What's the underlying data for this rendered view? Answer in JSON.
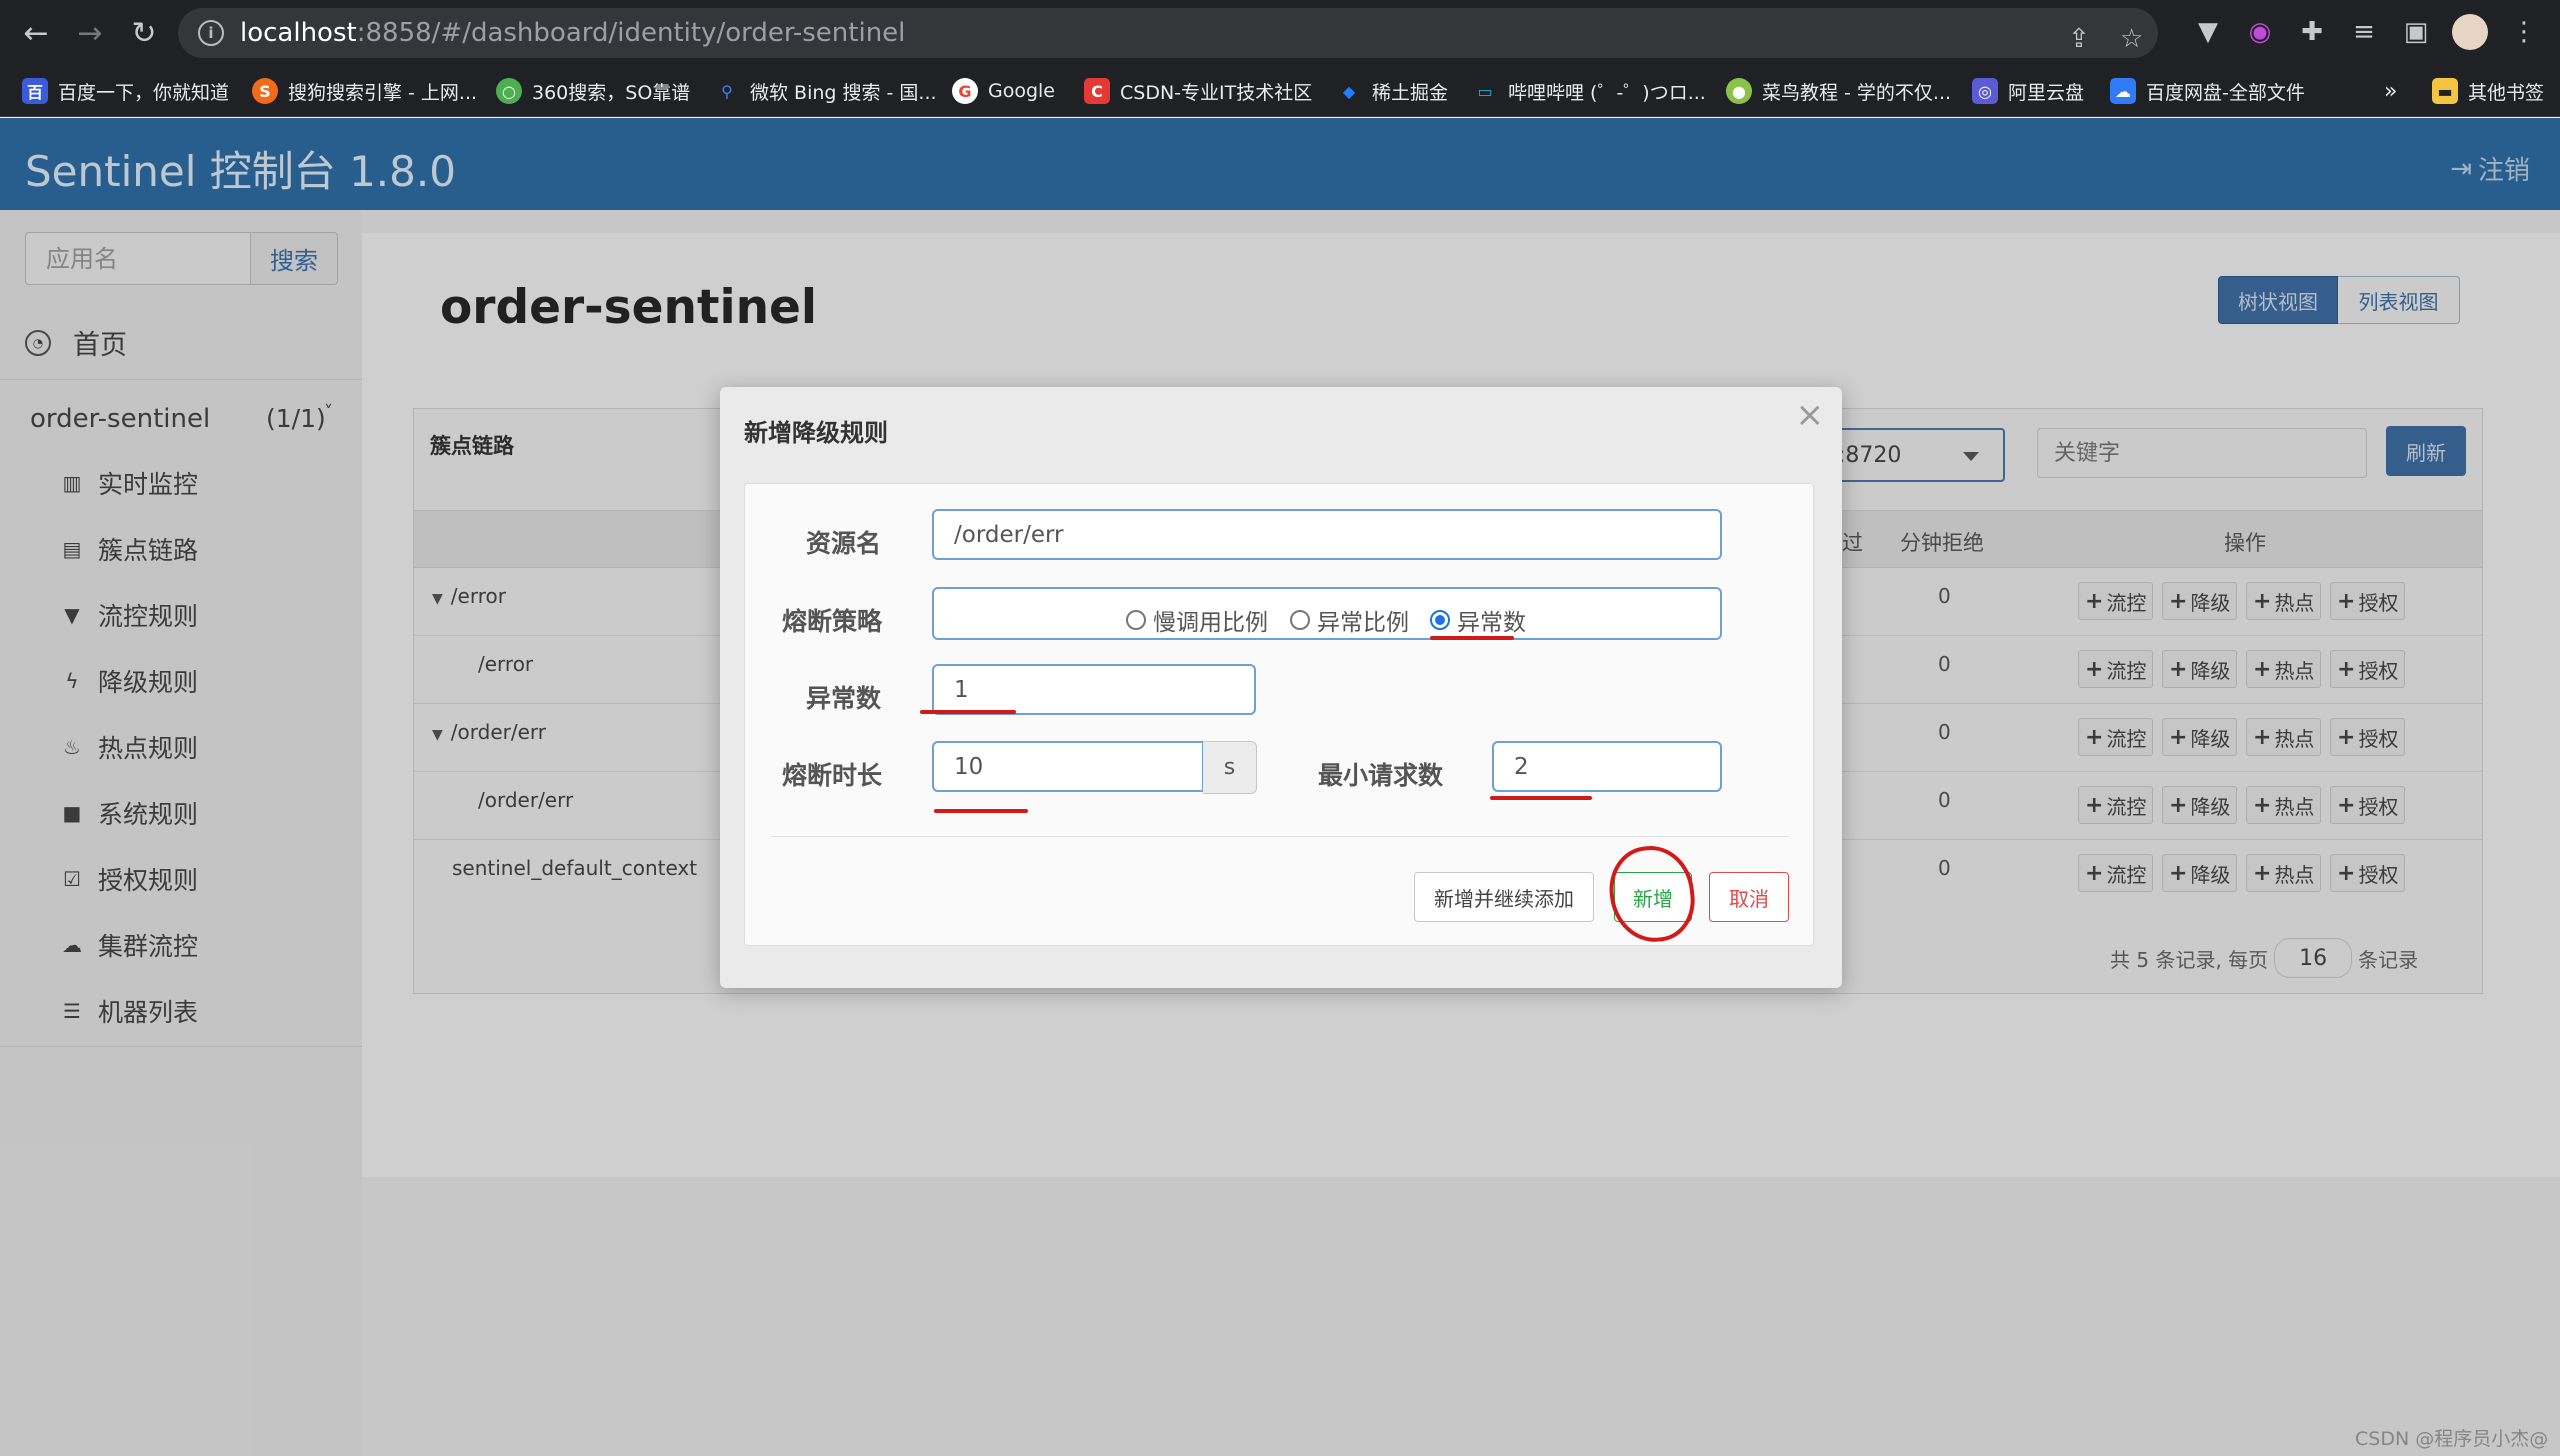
{
  "browser": {
    "url_host": "localhost",
    "url_path": ":8858/#/dashboard/identity/order-sentinel",
    "bookmarks": [
      {
        "label": "百度一下，你就知道",
        "icon": "baidu-icon",
        "color": "#3b5bdb"
      },
      {
        "label": "搜狗搜索引擎 - 上网...",
        "icon": "sogou-icon",
        "color": "#f26a1b"
      },
      {
        "label": "360搜索，SO靠谱",
        "icon": "so360-icon",
        "color": "#4caf50"
      },
      {
        "label": "微软 Bing 搜索 - 国...",
        "icon": "bing-search-icon",
        "color": "#3b82f6"
      },
      {
        "label": "Google",
        "icon": "google-icon",
        "color": "#ea4335"
      },
      {
        "label": "CSDN-专业IT技术社区",
        "icon": "csdn-icon",
        "color": "#e53935"
      },
      {
        "label": "稀土掘金",
        "icon": "juejin-icon",
        "color": "#1e80ff"
      },
      {
        "label": "哔哩哔哩 (゜-゜)つロ...",
        "icon": "bilibili-icon",
        "color": "#23ade5"
      },
      {
        "label": "菜鸟教程 - 学的不仅...",
        "icon": "runoob-icon",
        "color": "#8bc34a"
      },
      {
        "label": "阿里云盘",
        "icon": "aliyun-drive-icon",
        "color": "#5b5bd6"
      },
      {
        "label": "百度网盘-全部文件",
        "icon": "baidu-pan-icon",
        "color": "#2f7cf6"
      }
    ],
    "more": "»",
    "other_bookmarks": "其他书签"
  },
  "header": {
    "title": "Sentinel 控制台 1.8.0",
    "logout": "注销"
  },
  "sidebar": {
    "search_placeholder": "应用名",
    "search_button": "搜索",
    "home": "首页",
    "app_name": "order-sentinel",
    "app_count": "(1/1)",
    "items": [
      {
        "label": "实时监控",
        "icon": "bar-chart-icon"
      },
      {
        "label": "簇点链路",
        "icon": "list-alt-icon"
      },
      {
        "label": "流控规则",
        "icon": "filter-icon"
      },
      {
        "label": "降级规则",
        "icon": "flash-icon"
      },
      {
        "label": "热点规则",
        "icon": "fire-icon"
      },
      {
        "label": "系统规则",
        "icon": "lock-icon"
      },
      {
        "label": "授权规则",
        "icon": "check-icon"
      },
      {
        "label": "集群流控",
        "icon": "cloud-icon"
      },
      {
        "label": "机器列表",
        "icon": "th-list-icon"
      }
    ]
  },
  "main": {
    "title": "order-sentinel",
    "view_tree": "树状视图",
    "view_list": "列表视图",
    "panel_title": "簇点链路",
    "machine_select_value": ":8720",
    "keyword_placeholder": "关键字",
    "refresh": "刷新",
    "columns": {
      "pass": "过",
      "reject": "分钟拒绝",
      "ops": "操作"
    },
    "rows": [
      {
        "resource": "/error",
        "expandable": true,
        "indent": 0,
        "reject": "0"
      },
      {
        "resource": "/error",
        "expandable": false,
        "indent": 1,
        "reject": "0"
      },
      {
        "resource": "/order/err",
        "expandable": true,
        "indent": 0,
        "reject": "0"
      },
      {
        "resource": "/order/err",
        "expandable": false,
        "indent": 1,
        "reject": "0"
      },
      {
        "resource": "sentinel_default_context",
        "expandable": false,
        "indent": 0,
        "reject": "0"
      }
    ],
    "ops": [
      "流控",
      "降级",
      "热点",
      "授权"
    ],
    "pagination": {
      "prefix": "共 5 条记录, 每页",
      "page_size": "16",
      "suffix": "条记录"
    }
  },
  "modal": {
    "title": "新增降级规则",
    "close": "×",
    "resource_label": "资源名",
    "resource_value": "/order/err",
    "strategy_label": "熔断策略",
    "strategies": [
      {
        "label": "慢调用比例",
        "checked": false
      },
      {
        "label": "异常比例",
        "checked": false
      },
      {
        "label": "异常数",
        "checked": true
      }
    ],
    "exception_count_label": "异常数",
    "exception_count_value": "1",
    "duration_label": "熔断时长",
    "duration_value": "10",
    "duration_unit": "s",
    "min_request_label": "最小请求数",
    "min_request_value": "2",
    "btn_add_continue": "新增并继续添加",
    "btn_add": "新增",
    "btn_cancel": "取消"
  },
  "watermark": "CSDN @程序员小杰@",
  "colors": {
    "header_bg": "#2e6da4",
    "primary": "#3d6da3",
    "success": "#2aa346",
    "danger": "#dd4b4b",
    "annotation": "#d11a1a"
  }
}
